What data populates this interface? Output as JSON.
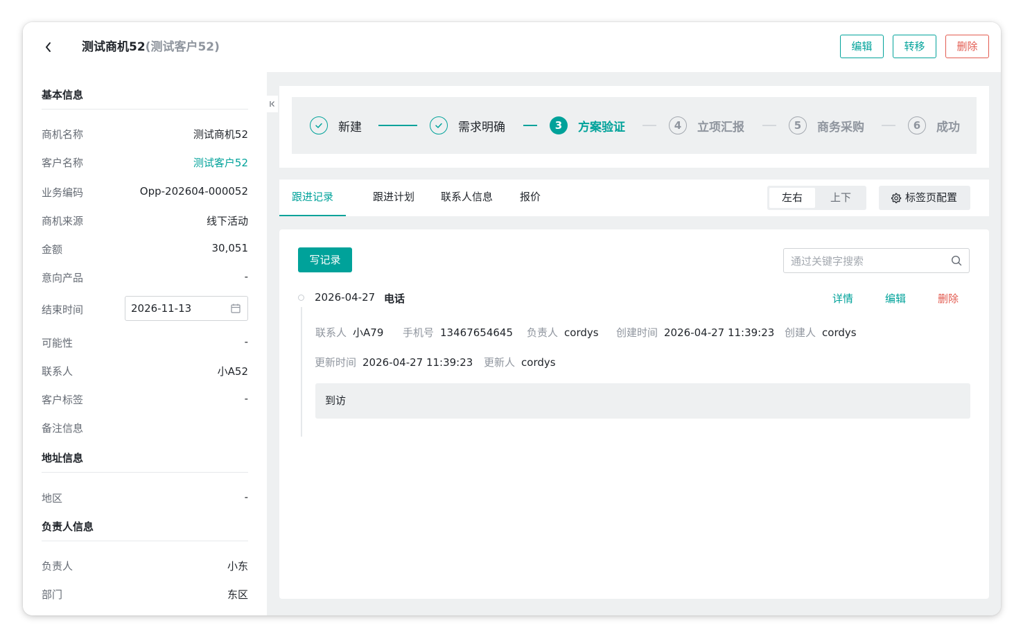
{
  "header": {
    "title": "测试商机52",
    "subtitle": "(测试客户52)",
    "edit_label": "编辑",
    "transfer_label": "转移",
    "delete_label": "删除"
  },
  "basic_info": {
    "title": "基本信息",
    "fields": [
      {
        "label": "商机名称",
        "value": "测试商机52"
      },
      {
        "label": "客户名称",
        "value": "测试客户52"
      },
      {
        "label": "业务编码",
        "value": "Opp-202604-000052"
      },
      {
        "label": "商机来源",
        "value": "线下活动"
      },
      {
        "label": "金额",
        "value": "30,051"
      },
      {
        "label": "意向产品",
        "value": "-"
      },
      {
        "label": "结束时间",
        "value": "2026-11-13"
      },
      {
        "label": "可能性",
        "value": "-"
      },
      {
        "label": "联系人",
        "value": "小A52"
      },
      {
        "label": "客户标签",
        "value": "-"
      },
      {
        "label": "备注信息",
        "value": ""
      }
    ]
  },
  "address_info": {
    "title": "地址信息",
    "fields": [
      {
        "label": "地区",
        "value": "-"
      }
    ]
  },
  "owner_info": {
    "title": "负责人信息",
    "fields": [
      {
        "label": "负责人",
        "value": "小东"
      },
      {
        "label": "部门",
        "value": "东区"
      }
    ]
  },
  "steps": [
    {
      "num": "1",
      "label": "新建",
      "status": "done"
    },
    {
      "num": "2",
      "label": "需求明确",
      "status": "done"
    },
    {
      "num": "3",
      "label": "方案验证",
      "status": "active"
    },
    {
      "num": "4",
      "label": "立项汇报",
      "status": "wait"
    },
    {
      "num": "5",
      "label": "商务采购",
      "status": "wait"
    },
    {
      "num": "6",
      "label": "成功",
      "status": "wait"
    }
  ],
  "tabs": [
    {
      "label": "跟进记录",
      "active": true
    },
    {
      "label": "跟进计划",
      "active": false
    },
    {
      "label": "联系人信息",
      "active": false
    },
    {
      "label": "报价",
      "active": false
    }
  ],
  "layout_toggle": {
    "left_right": "左右",
    "top_bottom": "上下",
    "selected": "左右"
  },
  "tab_config_label": "标签页配置",
  "records": {
    "write_label": "写记录",
    "search_placeholder": "通过关键字搜索",
    "items": [
      {
        "date": "2026-04-27",
        "type": "电话",
        "actions": {
          "detail": "详情",
          "edit": "编辑",
          "delete": "删除"
        },
        "contact_label": "联系人",
        "contact": "小A79",
        "phone_label": "手机号",
        "phone": "13467654645",
        "owner_label": "负责人",
        "owner": "cordys",
        "created_time_label": "创建时间",
        "created_time": "2026-04-27 11:39:23",
        "creator_label": "创建人",
        "creator": "cordys",
        "updated_time_label": "更新时间",
        "updated_time": "2026-04-27 11:39:23",
        "updater_label": "更新人",
        "updater": "cordys",
        "content": "到访"
      }
    ]
  },
  "colors": {
    "accent": "#00a29a",
    "danger": "#e25a4f",
    "panel_bg": "#eef0f1"
  }
}
